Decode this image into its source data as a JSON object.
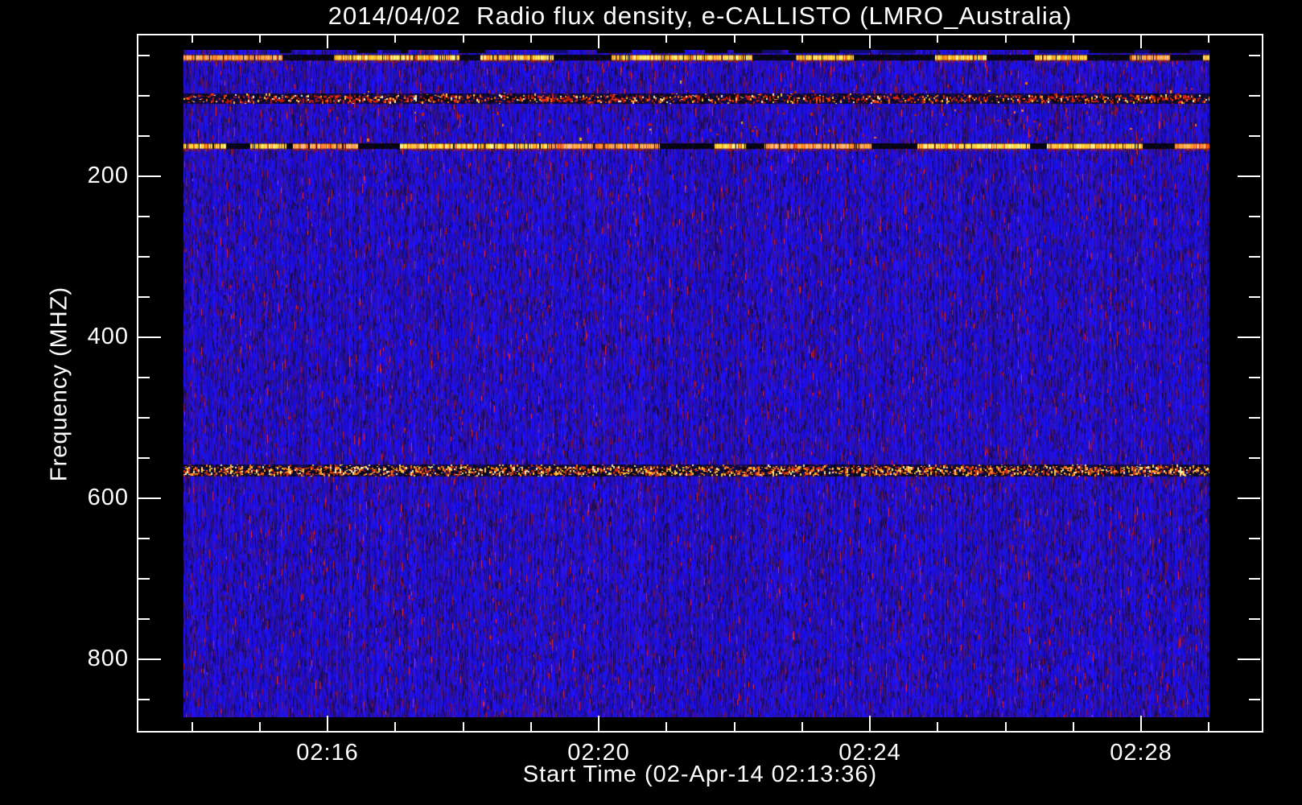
{
  "chart_data": {
    "type": "heatmap",
    "subtype": "radio-spectrogram",
    "title": "2014/04/02  Radio flux density, e-CALLISTO (LMRO_Australia)",
    "date": "2014/04/02",
    "instrument": "e-CALLISTO",
    "station": "LMRO_Australia",
    "xlabel": "Start Time (02-Apr-14 02:13:36)",
    "ylabel": "Frequency (MHZ)",
    "x_axis": {
      "start_time": "02:13:36",
      "major_tick_labels": [
        "02:16",
        "02:20",
        "02:24",
        "02:28"
      ],
      "major_tick_interval_minutes": 4,
      "minor_ticks_between_majors": 3
    },
    "y_axis": {
      "major_tick_labels": [
        "200",
        "400",
        "600",
        "800"
      ],
      "unit": "MHz",
      "data_min_mhz": 45,
      "data_max_mhz": 870,
      "minor_tick_step_mhz": 50,
      "increases_downward": true
    },
    "grid": false,
    "legend": "none",
    "colormap": {
      "background_blue": "#1a10d8",
      "streak_purple": "#300f8a",
      "streak_dark": "#160648",
      "hot_red": "#c42008",
      "hot_orange": "#ff7818",
      "hot_yellow": "#ffd44a",
      "hot_white": "#fff4cc",
      "dropout_black": "#000000",
      "text": "#ffffff"
    },
    "rfi_bands": [
      {
        "name": "rfi-band-52mhz",
        "freq_mhz": 52,
        "pattern": "intermittent-bright-dropout"
      },
      {
        "name": "rfi-band-103mhz",
        "freq_mhz": 103,
        "pattern": "continuous-red-speckle"
      },
      {
        "name": "rfi-band-162mhz",
        "freq_mhz": 162,
        "pattern": "intermittent-bright-dropout"
      },
      {
        "name": "rfi-band-565mhz",
        "freq_mhz": 565,
        "pattern": "continuous-hot-speckle"
      },
      {
        "name": "scattered-interference-dots",
        "freq_range_mhz": [
          80,
          155
        ],
        "pattern": "sparse-dots"
      }
    ]
  }
}
